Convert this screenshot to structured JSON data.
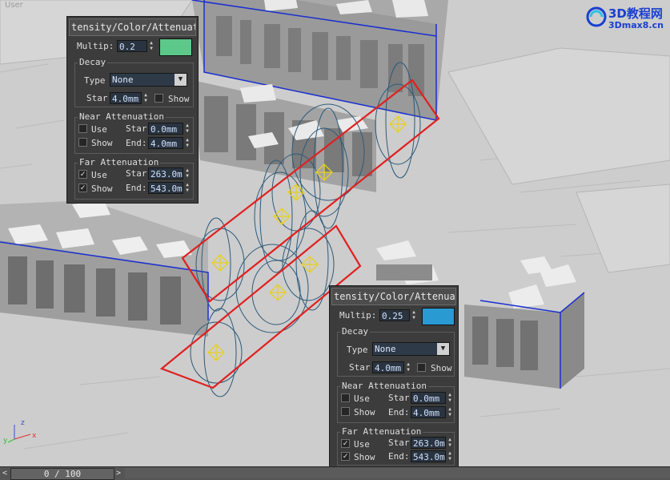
{
  "viewport": {
    "label": "User",
    "logo": {
      "line1_a": "3D",
      "line1_b": "教程网",
      "line2": "3Dmax8.cn"
    }
  },
  "panel_left": {
    "title": "tensity/Color/Attenuati",
    "multiplier_label": "Multip:",
    "multiplier_value": "0.2",
    "color": "#5cc98a",
    "decay": {
      "title": "Decay",
      "type_label": "Type",
      "type_value": "None",
      "start_label": "Star",
      "start_value": "4.0mm",
      "show_label": "Show"
    },
    "near": {
      "title": "Near Attenuation",
      "use_label": "Use",
      "show_label": "Show",
      "start_label": "Star",
      "start_value": "0.0mm",
      "end_label": "End:",
      "end_value": "4.0mm",
      "use_checked": false,
      "show_checked": false
    },
    "far": {
      "title": "Far Attenuation",
      "use_label": "Use",
      "show_label": "Show",
      "start_label": "Star",
      "start_value": "263.0m",
      "end_label": "End:",
      "end_value": "543.0m",
      "use_checked": true,
      "show_checked": true
    }
  },
  "panel_right": {
    "title": "tensity/Color/Attenuati",
    "multiplier_label": "Multip:",
    "multiplier_value": "0.25",
    "color": "#2a9ad2",
    "decay": {
      "title": "Decay",
      "type_label": "Type",
      "type_value": "None",
      "start_label": "Star",
      "start_value": "4.0mm",
      "show_label": "Show"
    },
    "near": {
      "title": "Near Attenuation",
      "use_label": "Use",
      "show_label": "Show",
      "start_label": "Star",
      "start_value": "0.0mm",
      "end_label": "End:",
      "end_value": "4.0mm",
      "use_checked": false,
      "show_checked": false
    },
    "far": {
      "title": "Far Attenuation",
      "use_label": "Use",
      "show_label": "Show",
      "start_label": "Star",
      "start_value": "263.0m",
      "end_label": "End:",
      "end_value": "543.0m",
      "use_checked": true,
      "show_checked": true
    }
  },
  "timeline": {
    "current": "0 / 100",
    "prev": "<",
    "next": ">"
  },
  "axis": {
    "x": "x",
    "y": "y",
    "z": "z"
  },
  "colors": {
    "selection": "#e02020",
    "bbox": "#1a2fd0",
    "light_gizmo": "#e8d020"
  }
}
